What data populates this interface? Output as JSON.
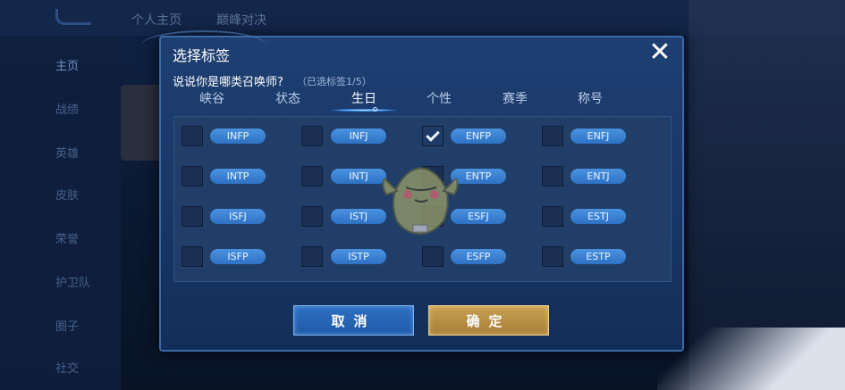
{
  "background": {
    "top_tabs": [
      "个人主页",
      "巅峰对决"
    ],
    "side_items": [
      "主页",
      "战绩",
      "英雄",
      "皮肤",
      "荣誉",
      "护卫队",
      "圈子",
      "社交"
    ]
  },
  "dialog": {
    "title": "选择标签",
    "close_icon": "close-icon",
    "question": "说说你是哪类召唤师?",
    "counter": "（已选标签1/5）",
    "tabs": [
      {
        "label": "峡谷",
        "active": false
      },
      {
        "label": "状态",
        "active": false
      },
      {
        "label": "生日",
        "active": true
      },
      {
        "label": "个性",
        "active": false
      },
      {
        "label": "赛季",
        "active": false
      },
      {
        "label": "称号",
        "active": false
      }
    ],
    "rows": [
      [
        {
          "tag": "INFP",
          "checked": false
        },
        {
          "tag": "INFJ",
          "checked": false
        },
        {
          "tag": "ENFP",
          "checked": true
        },
        {
          "tag": "ENFJ",
          "checked": false
        }
      ],
      [
        {
          "tag": "INTP",
          "checked": false
        },
        {
          "tag": "INTJ",
          "checked": false
        },
        {
          "tag": "ENTP",
          "checked": false
        },
        {
          "tag": "ENTJ",
          "checked": false
        }
      ],
      [
        {
          "tag": "ISFJ",
          "checked": false
        },
        {
          "tag": "ISTJ",
          "checked": false
        },
        {
          "tag": "ESFJ",
          "checked": false
        },
        {
          "tag": "ESTJ",
          "checked": false
        }
      ],
      [
        {
          "tag": "ISFP",
          "checked": false
        },
        {
          "tag": "ISTP",
          "checked": false
        },
        {
          "tag": "ESFP",
          "checked": false
        },
        {
          "tag": "ESTP",
          "checked": false
        }
      ]
    ],
    "cancel_label": "取消",
    "confirm_label": "确定"
  },
  "colors": {
    "dialog_bg": "#1e3f72",
    "pill": "#3a80d2",
    "cancel": "#2a67b8",
    "confirm": "#b98d44"
  }
}
